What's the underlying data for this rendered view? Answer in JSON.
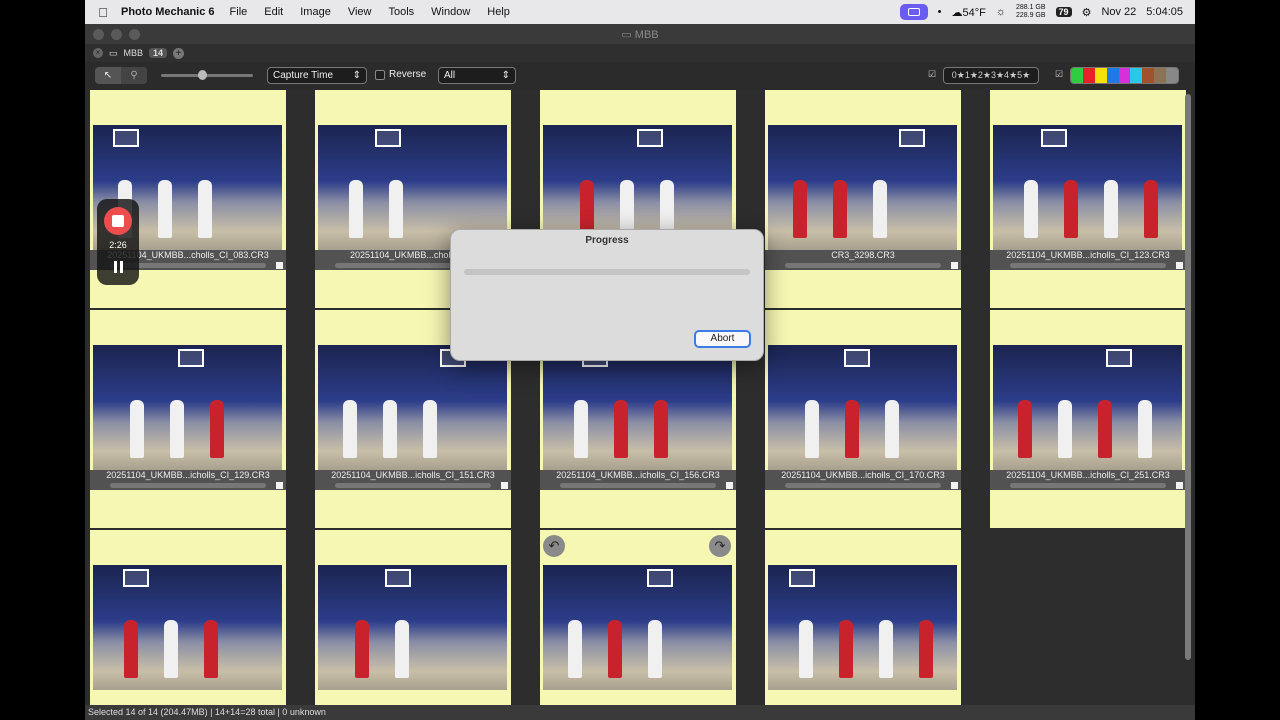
{
  "menubar": {
    "app_name": "Photo Mechanic 6",
    "menus": [
      "File",
      "Edit",
      "Image",
      "View",
      "Tools",
      "Window",
      "Help"
    ],
    "weather": "54°F",
    "storage_top": "288.1 GB",
    "storage_bottom": "228.9 GB",
    "battery": "79",
    "date": "Nov 22",
    "time": "5:04:05"
  },
  "window": {
    "title": "MBB",
    "tab_label": "MBB",
    "tab_count": "14"
  },
  "toolbar": {
    "sort_value": "Capture Time",
    "reverse_label": "Reverse",
    "filter_value": "All",
    "star_filter_label": "0★1★2★3★4★5★",
    "color_swatches": [
      "#2ecc40",
      "#e8202a",
      "#f5e20a",
      "#1e7ae8",
      "#d830d8",
      "#28c8e8",
      "#a0522d",
      "#8b7355",
      "#888888"
    ]
  },
  "grid": {
    "captions": [
      "20251104_UKMBB...cholls_CI_083.CR3",
      "20251104_UKMBB...cholls_CI_",
      "",
      "CR3_3298.CR3",
      "20251104_UKMBB...icholls_CI_123.CR3",
      "20251104_UKMBB...icholls_CI_129.CR3",
      "20251104_UKMBB...icholls_CI_151.CR3",
      "20251104_UKMBB...icholls_CI_156.CR3",
      "20251104_UKMBB...icholls_CI_170.CR3",
      "20251104_UKMBB...icholls_CI_251.CR3"
    ]
  },
  "progress_dialog": {
    "title": "Progress",
    "progress_fraction": 0,
    "abort_label": "Abort"
  },
  "recording": {
    "elapsed": "2:26"
  },
  "statusbar": {
    "text": "Selected 14 of 14 (204.47MB) | 14+14=28 total | 0 unknown"
  }
}
